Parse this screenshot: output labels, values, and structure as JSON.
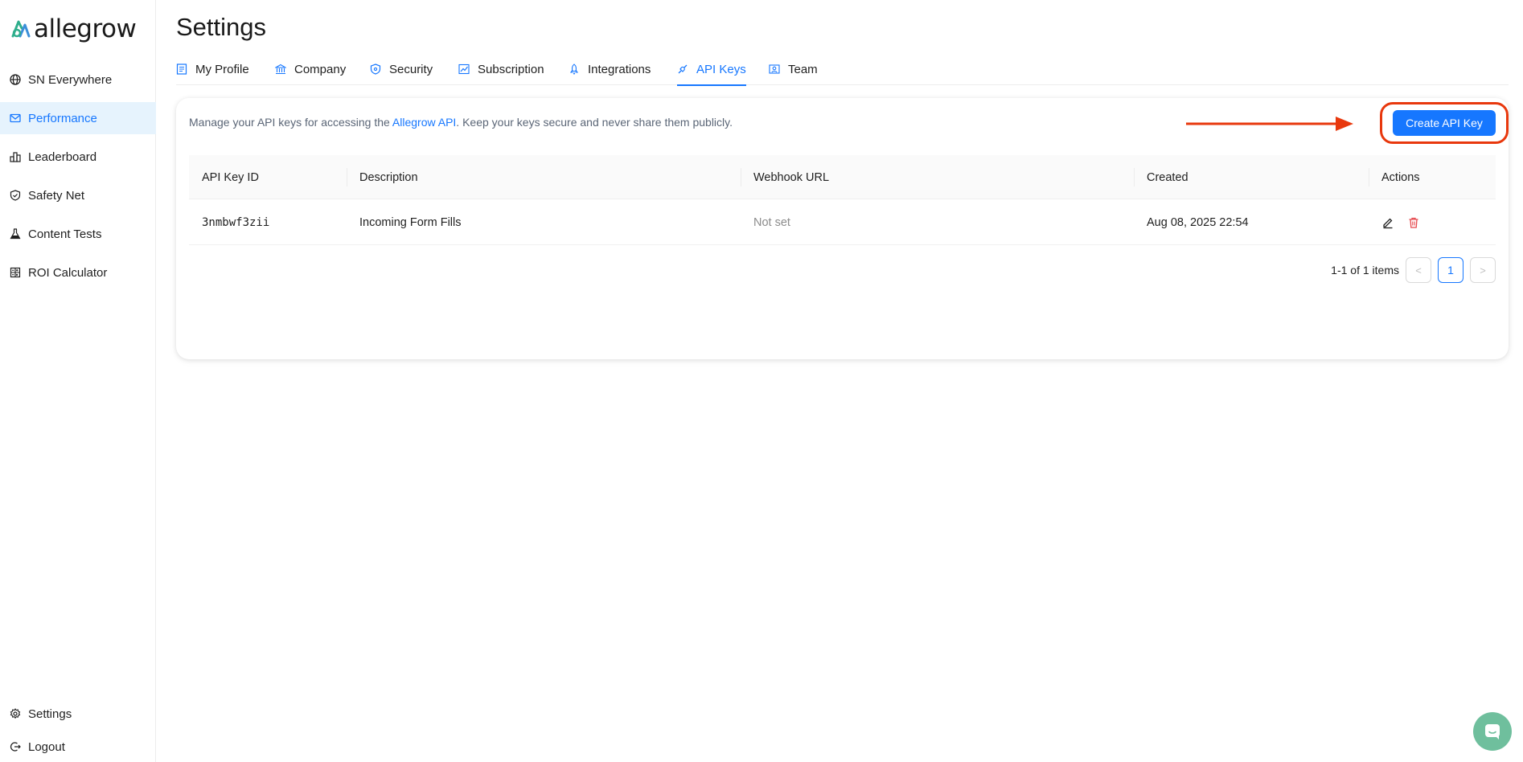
{
  "app": {
    "logo_text": "allegrow"
  },
  "sidebar": {
    "items": [
      {
        "label": "SN Everywhere",
        "icon": "globe-icon"
      },
      {
        "label": "Performance",
        "icon": "mail-icon",
        "active": true
      },
      {
        "label": "Leaderboard",
        "icon": "podium-icon"
      },
      {
        "label": "Safety Net",
        "icon": "shield-icon"
      },
      {
        "label": "Content Tests",
        "icon": "flask-icon"
      },
      {
        "label": "ROI Calculator",
        "icon": "calculator-icon"
      }
    ],
    "bottom": [
      {
        "label": "Settings",
        "icon": "gear-icon"
      },
      {
        "label": "Logout",
        "icon": "logout-icon"
      }
    ]
  },
  "page": {
    "title": "Settings"
  },
  "tabs": [
    {
      "label": "My Profile",
      "icon": "profile-icon"
    },
    {
      "label": "Company",
      "icon": "bank-icon"
    },
    {
      "label": "Security",
      "icon": "security-icon"
    },
    {
      "label": "Subscription",
      "icon": "chart-icon"
    },
    {
      "label": "Integrations",
      "icon": "rocket-icon"
    },
    {
      "label": "API Keys",
      "icon": "api-icon",
      "active": true
    },
    {
      "label": "Team",
      "icon": "team-icon"
    }
  ],
  "api_keys": {
    "description_prefix": "Manage your API keys for accessing the ",
    "description_link": "Allegrow API",
    "description_suffix": ". Keep your keys secure and never share them publicly.",
    "create_button": "Create API Key",
    "columns": [
      "API Key ID",
      "Description",
      "Webhook URL",
      "Created",
      "Actions"
    ],
    "rows": [
      {
        "id": "3nmbwf3zii",
        "description": "Incoming Form Fills",
        "webhook": "Not set",
        "created": "Aug 08, 2025 22:54"
      }
    ],
    "pagination": {
      "summary": "1-1 of 1 items",
      "current_page": "1",
      "prev": "<",
      "next": ">"
    }
  },
  "colors": {
    "accent": "#1677ff",
    "annotation": "#e8380d",
    "delete": "#e5484d",
    "chat": "#6fbf9d"
  }
}
